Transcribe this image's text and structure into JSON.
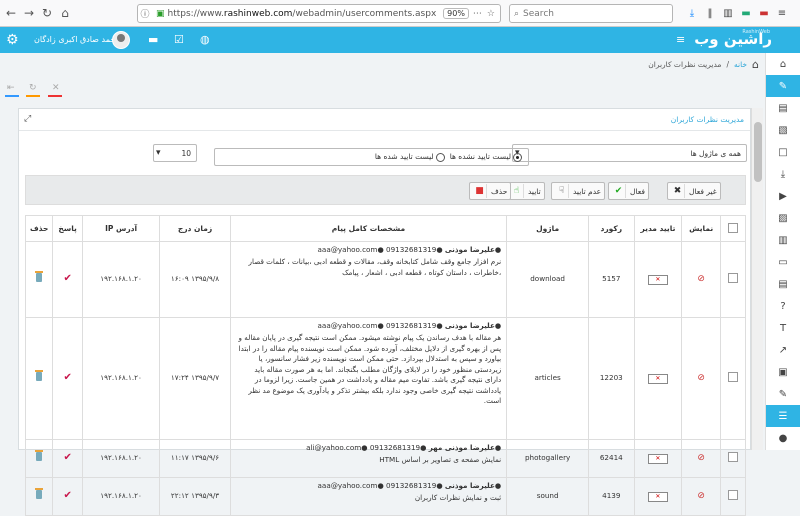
{
  "browser": {
    "url_prefix": "https://www.",
    "url_domain": "rashinweb.com",
    "url_path": "/webadmin/usercomments.aspx",
    "zoom": "90%",
    "search_placeholder": "Search"
  },
  "header": {
    "user_name": "محمد صادق اکبری زادگان",
    "logo_text": "راشین وب",
    "logo_sub": "RashinWeb"
  },
  "breadcrumb": {
    "home": "خانه",
    "separator": "/",
    "current": "مدیریت نظرات کاربران"
  },
  "panel": {
    "title": "مدیریت نظرات کاربران",
    "module_select": "همه ی ماژول ها",
    "radio_unapproved": "لیست تایید نشده ها",
    "radio_approved": "لیست تایید شده ها",
    "page_size": "10"
  },
  "actions": {
    "inactive": "غیر فعال",
    "active": "فعال",
    "disapprove": "عدم تایید",
    "approve": "تایید",
    "delete": "حذف"
  },
  "table": {
    "headers": [
      "",
      "نمایش",
      "تایید مدیر",
      "رکورد",
      "ماژول",
      "مشخصات کامل پیام",
      "زمان درج",
      "آدرس IP",
      "پاسخ",
      "حذف"
    ],
    "rows": [
      {
        "author": "علیرضا موذنی",
        "phone": "09132681319",
        "email": "aaa@yahoo.com",
        "message": "نرم افزار جامع وقف شامل کتابخانه وقف، مقالات و قطعه ادبی ،بیانات ، کلمات قصار ،خاطرات ، داستان کوتاه ، قطعه ادبی ، اشعار ، پیامک",
        "module": "download",
        "record": "5157",
        "date": "۱۳۹۵/۹/۸ ۱۶:۰۹",
        "ip": "۱۹۲.۱۶۸.۱.۲۰"
      },
      {
        "author": "علیرضا موذنی",
        "phone": "09132681319",
        "email": "aaa@yahoo.com",
        "message": "هر مقاله با هدف رساندن یک پیام نوشته میشود. ممکن است نتیجه گیری در پایان مقاله و پس از بهره گیری از دلایل مختلف، آورده شود. ممکن است نویسنده پیام مقاله را در ابتدا بیاورد و سپس به استدلال بپردازد. حتی ممکن است نویسنده زیر فشار سانسور، یا زیردستی منظور خود را در لابلای واژگان مطلب بگنجاند. اما به هر صورت مقاله باید دارای نتیجه گیری باشد. تفاوت میم مقاله و یادداشت در همین جاست. زیرا لزوما در یادداشت نتیجه گیری خاصی وجود ندارد بلکه بیشتر تذکر و یادآوری یک موضوع مد نظر است.",
        "module": "articles",
        "record": "12203",
        "date": "۱۳۹۵/۹/۷ ۱۷:۲۴",
        "ip": "۱۹۲.۱۶۸.۱.۲۰"
      },
      {
        "author": "علیرضا موذنی مهر",
        "phone": "09132681319",
        "email": "ali@yahoo.com",
        "message": "نمایش صفحه ی تصاویر بر اساس HTML",
        "module": "photogallery",
        "record": "62414",
        "date": "۱۳۹۵/۹/۶ ۱۱:۱۷",
        "ip": "۱۹۲.۱۶۸.۱.۲۰"
      },
      {
        "author": "علیرضا موذنی",
        "phone": "09132681319",
        "email": "aaa@yahoo.com",
        "message": "ثبت و نمایش نظرات کاربران",
        "module": "sound",
        "record": "4139",
        "date": "۱۳۹۵/۹/۳ ۲۲:۱۲",
        "ip": "۱۹۲.۱۶۸.۱.۲۰"
      }
    ]
  },
  "colors": {
    "accent": "#2fb4e4",
    "check": "#c8174c"
  }
}
